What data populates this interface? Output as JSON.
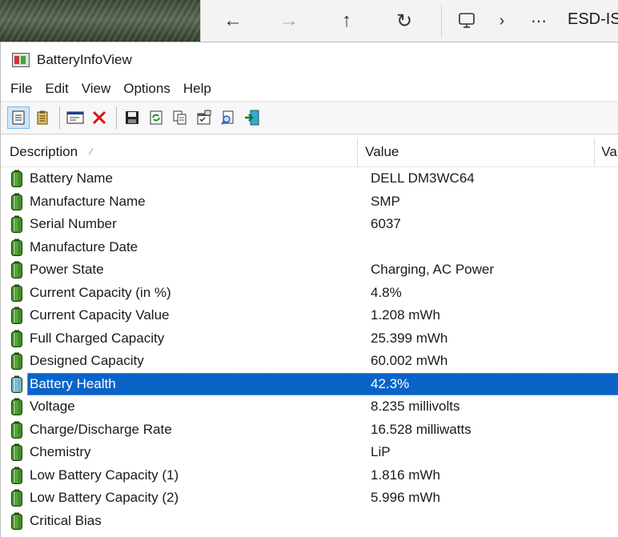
{
  "explorer": {
    "title": "ESD-ISO"
  },
  "window": {
    "title": "BatteryInfoView"
  },
  "menu": [
    "File",
    "Edit",
    "View",
    "Options",
    "Help"
  ],
  "columns": {
    "description": "Description",
    "value": "Value",
    "third": "Va"
  },
  "rows": [
    {
      "label": "Battery Name",
      "value": "DELL DM3WC64"
    },
    {
      "label": "Manufacture Name",
      "value": "SMP"
    },
    {
      "label": "Serial Number",
      "value": "6037"
    },
    {
      "label": "Manufacture Date",
      "value": ""
    },
    {
      "label": "Power State",
      "value": "Charging, AC Power"
    },
    {
      "label": "Current Capacity (in %)",
      "value": "4.8%"
    },
    {
      "label": "Current Capacity Value",
      "value": "1.208 mWh"
    },
    {
      "label": "Full Charged Capacity",
      "value": "25.399 mWh"
    },
    {
      "label": "Designed Capacity",
      "value": "60.002 mWh"
    },
    {
      "label": "Battery Health",
      "value": "42.3%",
      "selected": true
    },
    {
      "label": "Voltage",
      "value": "8.235 millivolts"
    },
    {
      "label": "Charge/Discharge Rate",
      "value": "16.528 milliwatts"
    },
    {
      "label": "Chemistry",
      "value": "LiP"
    },
    {
      "label": "Low Battery Capacity (1)",
      "value": "1.816 mWh"
    },
    {
      "label": "Low Battery Capacity (2)",
      "value": "5.996 mWh"
    },
    {
      "label": "Critical Bias",
      "value": ""
    }
  ],
  "colors": {
    "selection": "#0a64c8",
    "battery_green": "#3f8f22"
  }
}
